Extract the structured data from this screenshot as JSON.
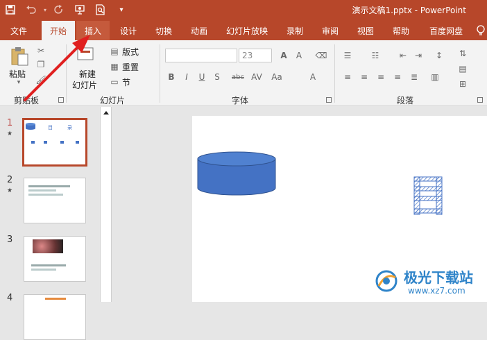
{
  "app": {
    "document_title": "演示文稿1.pptx - PowerPoint"
  },
  "qat": {
    "icons": [
      "save-icon",
      "undo-icon",
      "redo-icon",
      "present-icon",
      "print-preview-icon",
      "customize-icon"
    ]
  },
  "tabs": [
    {
      "label": "文件",
      "state": "normal"
    },
    {
      "label": "开始",
      "state": "active"
    },
    {
      "label": "插入",
      "state": "hot"
    },
    {
      "label": "设计",
      "state": "normal"
    },
    {
      "label": "切换",
      "state": "normal"
    },
    {
      "label": "动画",
      "state": "normal"
    },
    {
      "label": "幻灯片放映",
      "state": "normal"
    },
    {
      "label": "录制",
      "state": "normal"
    },
    {
      "label": "审阅",
      "state": "normal"
    },
    {
      "label": "视图",
      "state": "normal"
    },
    {
      "label": "帮助",
      "state": "normal"
    },
    {
      "label": "百度网盘",
      "state": "normal"
    }
  ],
  "ribbon": {
    "clipboard": {
      "paste": "粘贴",
      "group": "剪贴板"
    },
    "slides": {
      "new_slide_1": "新建",
      "new_slide_2": "幻灯片",
      "layout": "版式",
      "reset": "重置",
      "section": "节",
      "group": "幻灯片"
    },
    "font": {
      "size": "23",
      "group": "字体"
    },
    "paragraph": {
      "group": "段落"
    }
  },
  "slides": [
    {
      "number": "1",
      "selected": true
    },
    {
      "number": "2",
      "selected": false
    },
    {
      "number": "3",
      "selected": false
    },
    {
      "number": "4",
      "selected": false
    }
  ],
  "thumbnail1": {
    "title": "目",
    "title2": "录"
  },
  "watermark": {
    "brand": "极光下载站",
    "url": "www.xz7.com"
  },
  "colors": {
    "accent": "#b7472a",
    "shape_blue": "#4472c4"
  }
}
